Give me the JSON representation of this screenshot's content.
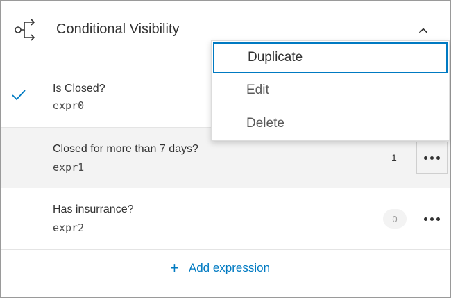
{
  "panel": {
    "title": "Conditional Visibility",
    "header_icon": "branch-icon",
    "collapse_icon": "chevron-up-icon"
  },
  "expressions": [
    {
      "label": "Is Closed?",
      "expr": "expr0",
      "selected": true,
      "count": ""
    },
    {
      "label": "Closed for more than 7 days?",
      "expr": "expr1",
      "selected": false,
      "count": "1"
    },
    {
      "label": "Has insurrance?",
      "expr": "expr2",
      "selected": false,
      "count": "0"
    }
  ],
  "menu": {
    "items": [
      {
        "label": "Duplicate",
        "focused": true
      },
      {
        "label": "Edit",
        "focused": false
      },
      {
        "label": "Delete",
        "focused": false
      }
    ]
  },
  "footer": {
    "add_label": "Add expression",
    "add_icon": "plus-icon"
  },
  "colors": {
    "accent": "#007ac2",
    "text": "#323232",
    "row_highlight": "#f3f3f3",
    "border": "#9a9a9a"
  }
}
